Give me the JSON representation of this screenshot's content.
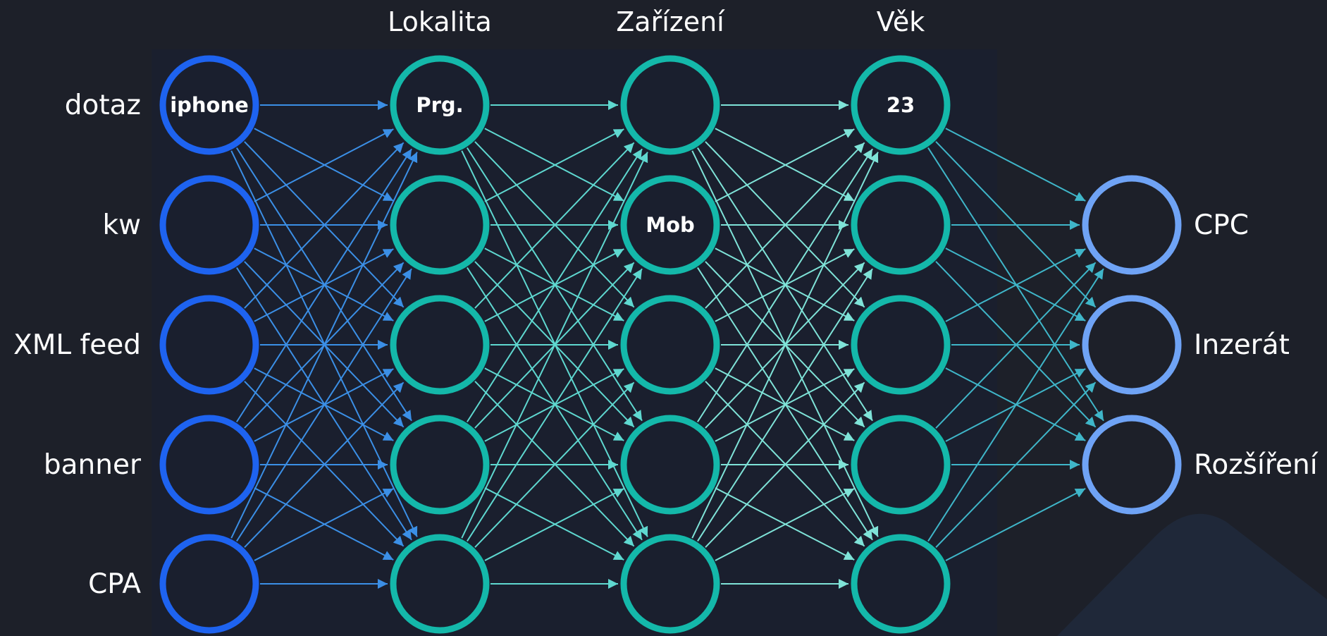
{
  "columns": [
    {
      "id": "input",
      "title": "",
      "color": "#1e63f0",
      "edge_color": "#3b8fe6",
      "nodes": [
        {
          "row_label": "dotaz",
          "text": "iphone"
        },
        {
          "row_label": "kw",
          "text": ""
        },
        {
          "row_label": "XML feed",
          "text": ""
        },
        {
          "row_label": "banner",
          "text": ""
        },
        {
          "row_label": "CPA",
          "text": ""
        }
      ]
    },
    {
      "id": "lokalita",
      "title": "Lokalita",
      "color": "#14b8aa",
      "edge_color": "#5fd8d0",
      "nodes": [
        {
          "text": "Prg."
        },
        {
          "text": ""
        },
        {
          "text": ""
        },
        {
          "text": ""
        },
        {
          "text": ""
        }
      ]
    },
    {
      "id": "zarizeni",
      "title": "Zařízení",
      "color": "#14b8aa",
      "edge_color": "#7fe3d8",
      "nodes": [
        {
          "text": ""
        },
        {
          "text": "Mob"
        },
        {
          "text": ""
        },
        {
          "text": ""
        },
        {
          "text": ""
        }
      ]
    },
    {
      "id": "vek",
      "title": "Věk",
      "color": "#14b8aa",
      "edge_color": "#3fb6c9",
      "nodes": [
        {
          "text": "23"
        },
        {
          "text": ""
        },
        {
          "text": ""
        },
        {
          "text": ""
        },
        {
          "text": ""
        }
      ]
    },
    {
      "id": "output",
      "title": "",
      "color": "#6fa3f5",
      "nodes": [
        {
          "out_label": "CPC",
          "text": ""
        },
        {
          "out_label": "Inzerát",
          "text": ""
        },
        {
          "out_label": "Rozšíření",
          "text": ""
        }
      ]
    }
  ],
  "colors": {
    "background": "#1d2029",
    "panel": "#1a1f2e",
    "text": "#ffffff"
  }
}
